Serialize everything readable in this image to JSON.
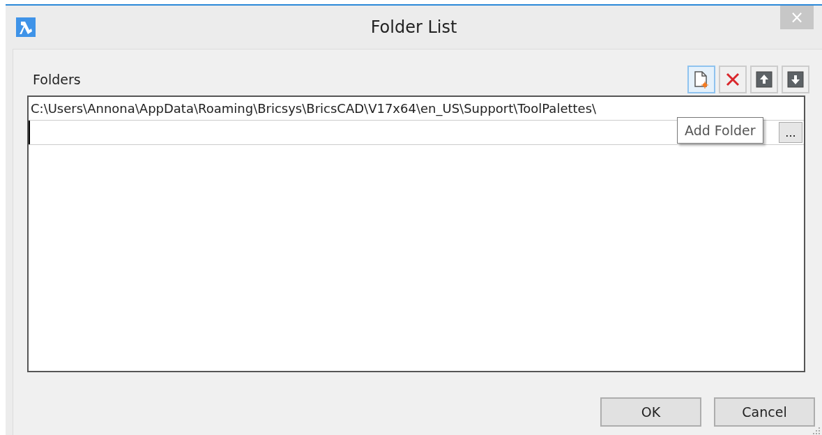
{
  "window": {
    "title": "Folder List",
    "close": "×"
  },
  "folders_label": "Folders",
  "toolbar": [
    {
      "kind": "add",
      "hovered": true
    },
    {
      "kind": "delete",
      "hovered": false
    },
    {
      "kind": "up",
      "hovered": false
    },
    {
      "kind": "down",
      "hovered": false
    }
  ],
  "tooltip": "Add Folder",
  "rows": [
    {
      "kind": "path",
      "text": "C:\\Users\\Annona\\AppData\\Roaming\\Bricsys\\BricsCAD\\V17x64\\en_US\\Support\\ToolPalettes\\"
    },
    {
      "kind": "edit",
      "browse": "..."
    }
  ],
  "buttons": [
    "OK",
    "Cancel"
  ]
}
